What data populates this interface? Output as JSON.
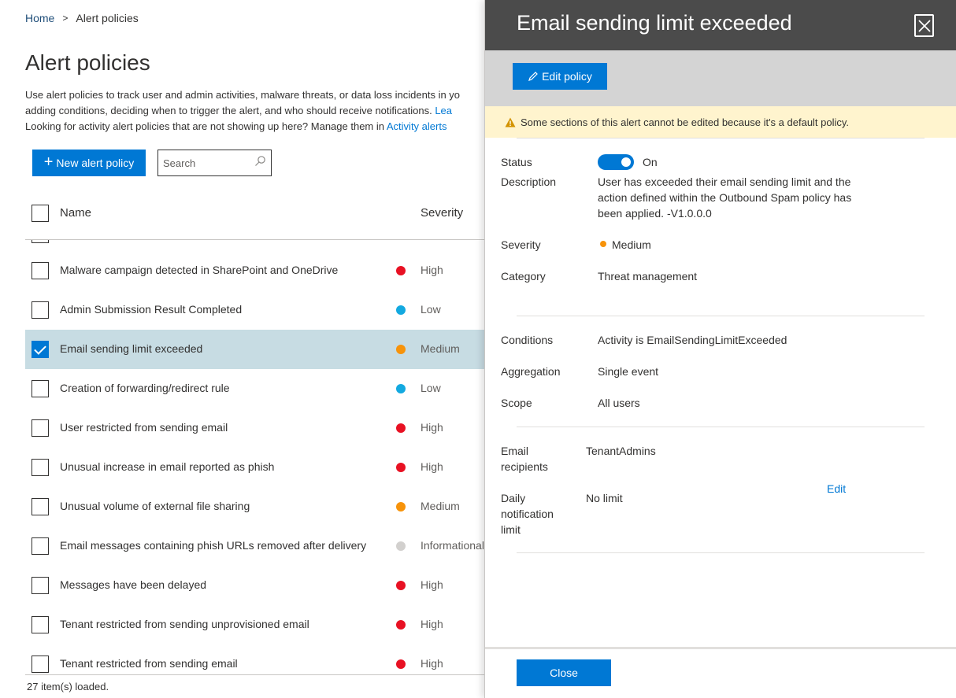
{
  "breadcrumb": {
    "home": "Home",
    "separator": ">",
    "current": "Alert policies"
  },
  "page": {
    "title": "Alert policies",
    "desc_line1": "Use alert policies to track user and admin activities, malware threats, or data loss incidents in yo",
    "desc_line2_text": "adding conditions, deciding when to trigger the alert, and who should receive notifications. ",
    "desc_line2_link": "Lea",
    "desc_line3_text": "Looking for activity alert policies that are not showing up here? Manage them in ",
    "desc_line3_link": "Activity alerts"
  },
  "toolbar": {
    "new_label": "New alert policy",
    "search_placeholder": "Search"
  },
  "table": {
    "col_name": "Name",
    "col_severity": "Severity",
    "rows": [
      {
        "name": "Malware campaign detected in SharePoint and OneDrive",
        "severity": "High",
        "color": "#e81123",
        "checked": false
      },
      {
        "name": "Admin Submission Result Completed",
        "severity": "Low",
        "color": "#13a9e0",
        "checked": false
      },
      {
        "name": "Email sending limit exceeded",
        "severity": "Medium",
        "color": "#f7930a",
        "checked": true
      },
      {
        "name": "Creation of forwarding/redirect rule",
        "severity": "Low",
        "color": "#13a9e0",
        "checked": false
      },
      {
        "name": "User restricted from sending email",
        "severity": "High",
        "color": "#e81123",
        "checked": false
      },
      {
        "name": "Unusual increase in email reported as phish",
        "severity": "High",
        "color": "#e81123",
        "checked": false
      },
      {
        "name": "Unusual volume of external file sharing",
        "severity": "Medium",
        "color": "#f7930a",
        "checked": false
      },
      {
        "name": "Email messages containing phish URLs removed after delivery",
        "severity": "Informational",
        "color": "#d2d0ce",
        "checked": false
      },
      {
        "name": "Messages have been delayed",
        "severity": "High",
        "color": "#e81123",
        "checked": false
      },
      {
        "name": "Tenant restricted from sending unprovisioned email",
        "severity": "High",
        "color": "#e81123",
        "checked": false
      },
      {
        "name": "Tenant restricted from sending email",
        "severity": "High",
        "color": "#e81123",
        "checked": false
      }
    ],
    "footer": "27 item(s) loaded."
  },
  "panel": {
    "title": "Email sending limit exceeded",
    "edit_policy_label": "Edit policy",
    "warning": "Some sections of this alert cannot be edited because it's a default policy.",
    "status_label": "Status",
    "status_value": "On",
    "description_label": "Description",
    "description_line1": "User has exceeded their email sending limit and the",
    "description_line2": "action defined within the Outbound Spam policy has",
    "description_line3": "been applied. -V1.0.0.0",
    "severity_label": "Severity",
    "severity_value": "Medium",
    "category_label": "Category",
    "category_value": "Threat management",
    "conditions_label": "Conditions",
    "conditions_value": "Activity is EmailSendingLimitExceeded",
    "aggregation_label": "Aggregation",
    "aggregation_value": "Single event",
    "scope_label": "Scope",
    "scope_value": "All users",
    "recipients_label_1": "Email",
    "recipients_label_2": "recipients",
    "recipients_value": "TenantAdmins",
    "daily_label_1": "Daily",
    "daily_label_2": "notification",
    "daily_label_3": "limit",
    "daily_value": "No limit",
    "edit_link": "Edit",
    "close_label": "Close"
  }
}
